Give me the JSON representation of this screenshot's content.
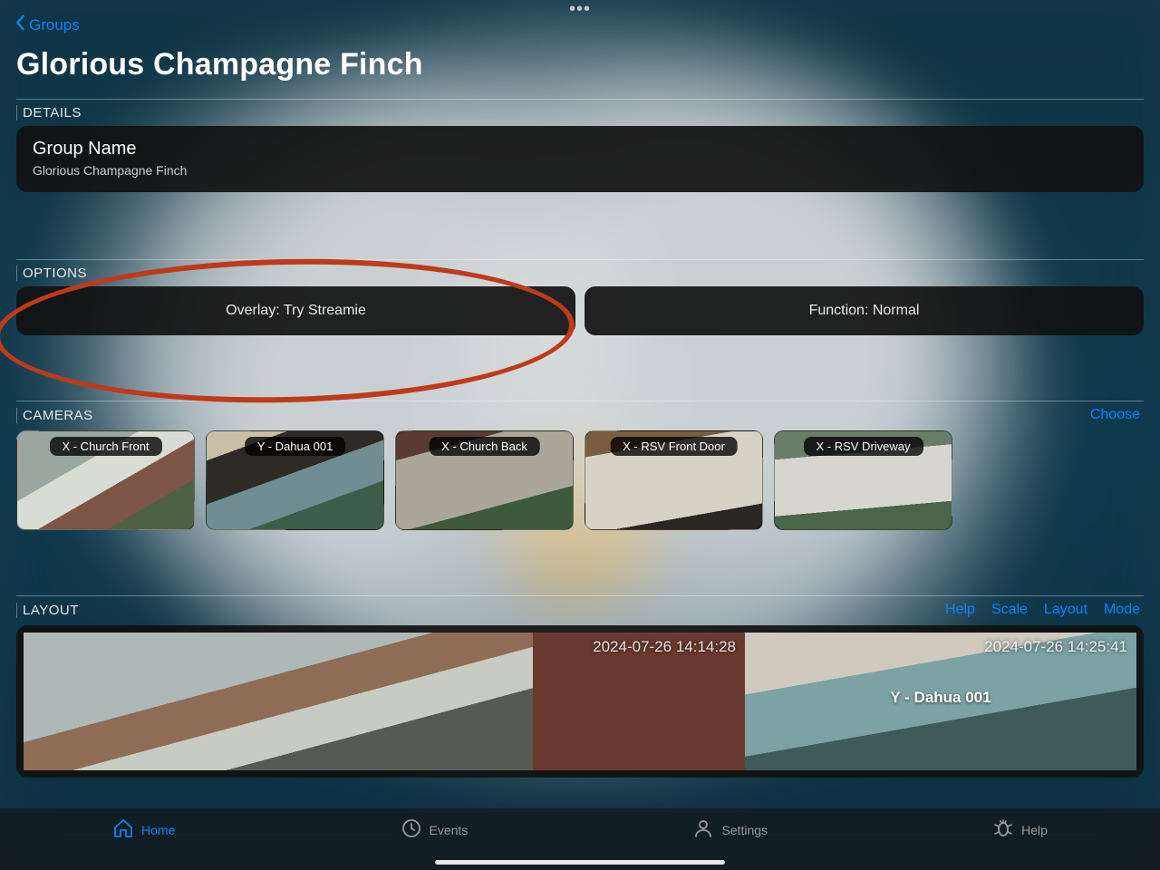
{
  "nav": {
    "back_label": "Groups"
  },
  "page": {
    "title": "Glorious Champagne Finch"
  },
  "details": {
    "section_title": "DETAILS",
    "group_name_label": "Group Name",
    "group_name_value": "Glorious Champagne Finch"
  },
  "options": {
    "section_title": "OPTIONS",
    "overlay_label": "Overlay: Try Streamie",
    "function_label": "Function: Normal"
  },
  "cameras": {
    "section_title": "CAMERAS",
    "choose_label": "Choose",
    "items": [
      {
        "label": "X - Church Front"
      },
      {
        "label": "Y - Dahua 001"
      },
      {
        "label": "X - Church Back"
      },
      {
        "label": "X - RSV Front Door"
      },
      {
        "label": "X - RSV Driveway"
      }
    ]
  },
  "layout": {
    "section_title": "LAYOUT",
    "actions": {
      "help": "Help",
      "scale": "Scale",
      "layout": "Layout",
      "mode": "Mode"
    },
    "tiles": [
      {
        "timestamp": ""
      },
      {
        "timestamp": "2024-07-26 14:14:28"
      },
      {
        "timestamp": "2024-07-26 14:25:41",
        "camera_name": "Y - Dahua 001"
      }
    ]
  },
  "tabs": {
    "home": "Home",
    "events": "Events",
    "settings": "Settings",
    "help": "Help"
  }
}
